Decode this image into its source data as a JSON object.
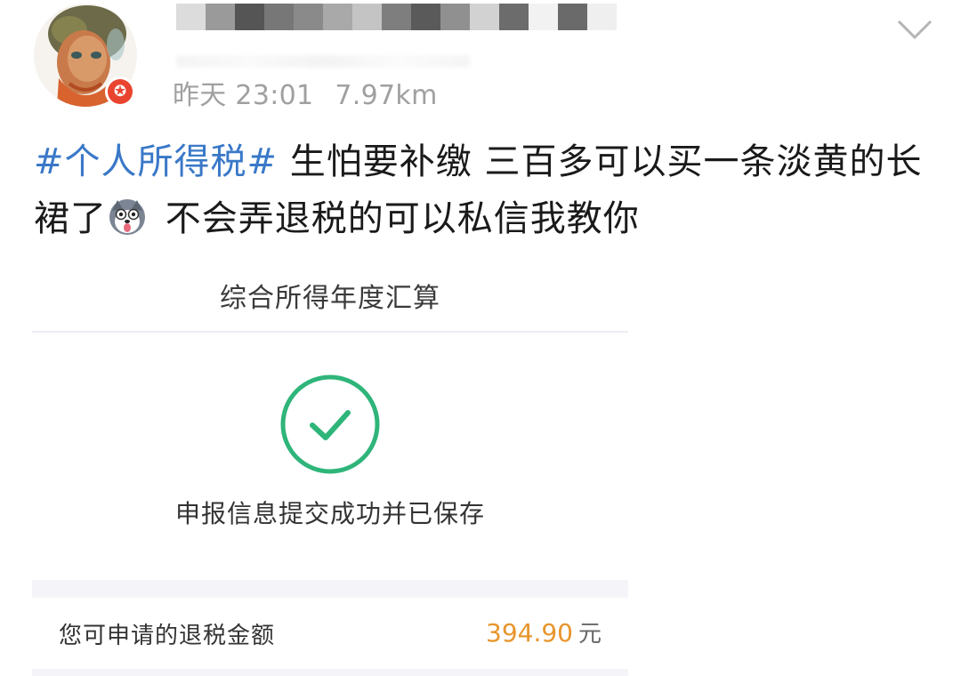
{
  "header": {
    "timestamp": "昨天 23:01",
    "distance": "7.97km",
    "badge_icon": "verified-star-icon",
    "menu_icon": "chevron-down-icon"
  },
  "post": {
    "hashtag": "#个人所得税#",
    "text_part1": " 生怕要补缴 三百多可以买一条淡黄的长裙了",
    "emoji": "husky-emoji",
    "text_part2": " 不会弄退税的可以私信我教你"
  },
  "card": {
    "title": "综合所得年度汇算",
    "status_icon": "check-circle-icon",
    "status_text": "申报信息提交成功并已保存",
    "refund_label": "您可申请的退税金额",
    "refund_amount": "394.90",
    "refund_unit": "元"
  },
  "colors": {
    "hashtag": "#3a78c8",
    "success_green": "#2fb57a",
    "amount_orange": "#e8952c",
    "badge_red": "#e8442f",
    "meta_gray": "#a0a0a0"
  }
}
